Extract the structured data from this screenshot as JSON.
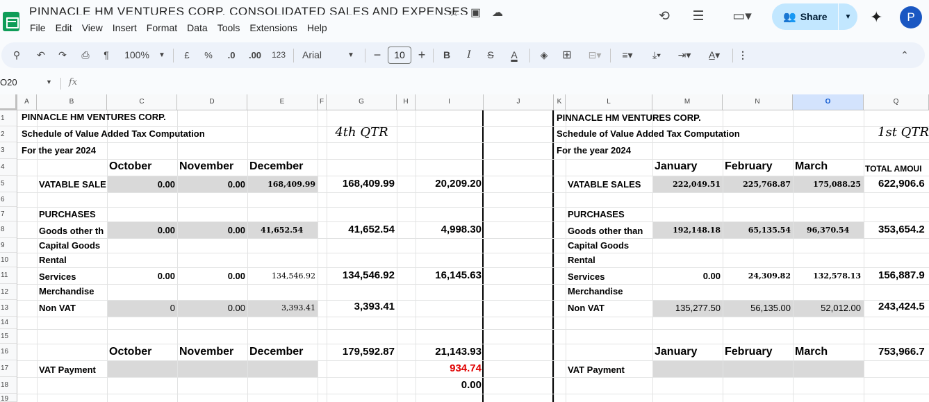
{
  "app": {
    "title": "PINNACLE HM VENTURES CORP. CONSOLIDATED SALES AND EXPENSES",
    "menu": [
      "File",
      "Edit",
      "View",
      "Insert",
      "Format",
      "Data",
      "Tools",
      "Extensions",
      "Help"
    ],
    "share_label": "Share",
    "avatar_letter": "P"
  },
  "toolbar": {
    "zoom": "100%",
    "currency": "£",
    "percent": "%",
    "dec_decrease": ".0",
    "dec_increase": ".00",
    "number_format": "123",
    "font": "Arial",
    "font_size": "10",
    "bold": "B",
    "italic": "I",
    "strike": "S",
    "text_color": "A"
  },
  "formula_bar": {
    "cell_ref": "O20",
    "fx": "fx",
    "value": ""
  },
  "columns": [
    "A",
    "B",
    "C",
    "D",
    "E",
    "F",
    "G",
    "H",
    "I",
    "J",
    "K",
    "L",
    "M",
    "N",
    "O",
    "Q"
  ],
  "selected_column": "O",
  "rows": [
    "1",
    "2",
    "3",
    "4",
    "5",
    "6",
    "7",
    "8",
    "9",
    "10",
    "11",
    "12",
    "13",
    "14",
    "15",
    "16",
    "17",
    "18",
    "19"
  ],
  "sheet": {
    "left": {
      "company": "PINNACLE HM VENTURES CORP.",
      "schedule": "Schedule of Value Added Tax Computation",
      "year": "For the year 2024",
      "quarter": "4th QTR",
      "months": [
        "October",
        "November",
        "December"
      ],
      "vatable_sales_label": "VATABLE SALE",
      "vatable_sales": [
        "0.00",
        "0.00",
        "168,409.99"
      ],
      "vatable_sales_total": "168,409.99",
      "vatable_sales_vat": "20,209.20",
      "purchases_label": "PURCHASES",
      "goods_label": "Goods other th",
      "goods": [
        "0.00",
        "0.00",
        "41,652.54"
      ],
      "goods_total": "41,652.54",
      "goods_vat": "4,998.30",
      "capital_goods_label": "Capital Goods",
      "rental_label": "Rental",
      "services_label": "Services",
      "services": [
        "0.00",
        "0.00",
        "134,546.92"
      ],
      "services_total": "134,546.92",
      "services_vat": "16,145.63",
      "merchandise_label": "Merchandise",
      "nonvat_label": "Non VAT",
      "nonvat": [
        "0",
        "0.00",
        "3,393.41"
      ],
      "nonvat_total": "3,393.41",
      "months2": [
        "October",
        "November",
        "December"
      ],
      "summary_total": "179,592.87",
      "summary_vat": "21,143.93",
      "vat_payment_label": "VAT Payment",
      "vat_payment": "934.74",
      "balance": "0.00"
    },
    "right": {
      "company": "PINNACLE HM VENTURES CORP.",
      "schedule": "Schedule of Value Added Tax Computation",
      "year": "For the year 2024",
      "quarter": "1st QTR",
      "months": [
        "January",
        "February",
        "March"
      ],
      "total_label": "TOTAL AMOUI",
      "vatable_sales_label": "VATABLE SALES",
      "vatable_sales": [
        "222,049.51",
        "225,768.87",
        "175,088.25"
      ],
      "vatable_sales_total": "622,906.6",
      "purchases_label": "PURCHASES",
      "goods_label": "Goods other than",
      "goods": [
        "192,148.18",
        "65,135.54",
        "96,370.54"
      ],
      "goods_total": "353,654.2",
      "capital_goods_label": "Capital Goods",
      "rental_label": "Rental",
      "services_label": "Services",
      "services": [
        "0.00",
        "24,309.82",
        "132,578.13"
      ],
      "services_total": "156,887.9",
      "merchandise_label": "Merchandise",
      "nonvat_label": "Non VAT",
      "nonvat": [
        "135,277.50",
        "56,135.00",
        "52,012.00"
      ],
      "nonvat_total": "243,424.5",
      "months2": [
        "January",
        "February",
        "March"
      ],
      "summary_total": "753,966.7",
      "vat_payment_label": "VAT Payment"
    }
  }
}
